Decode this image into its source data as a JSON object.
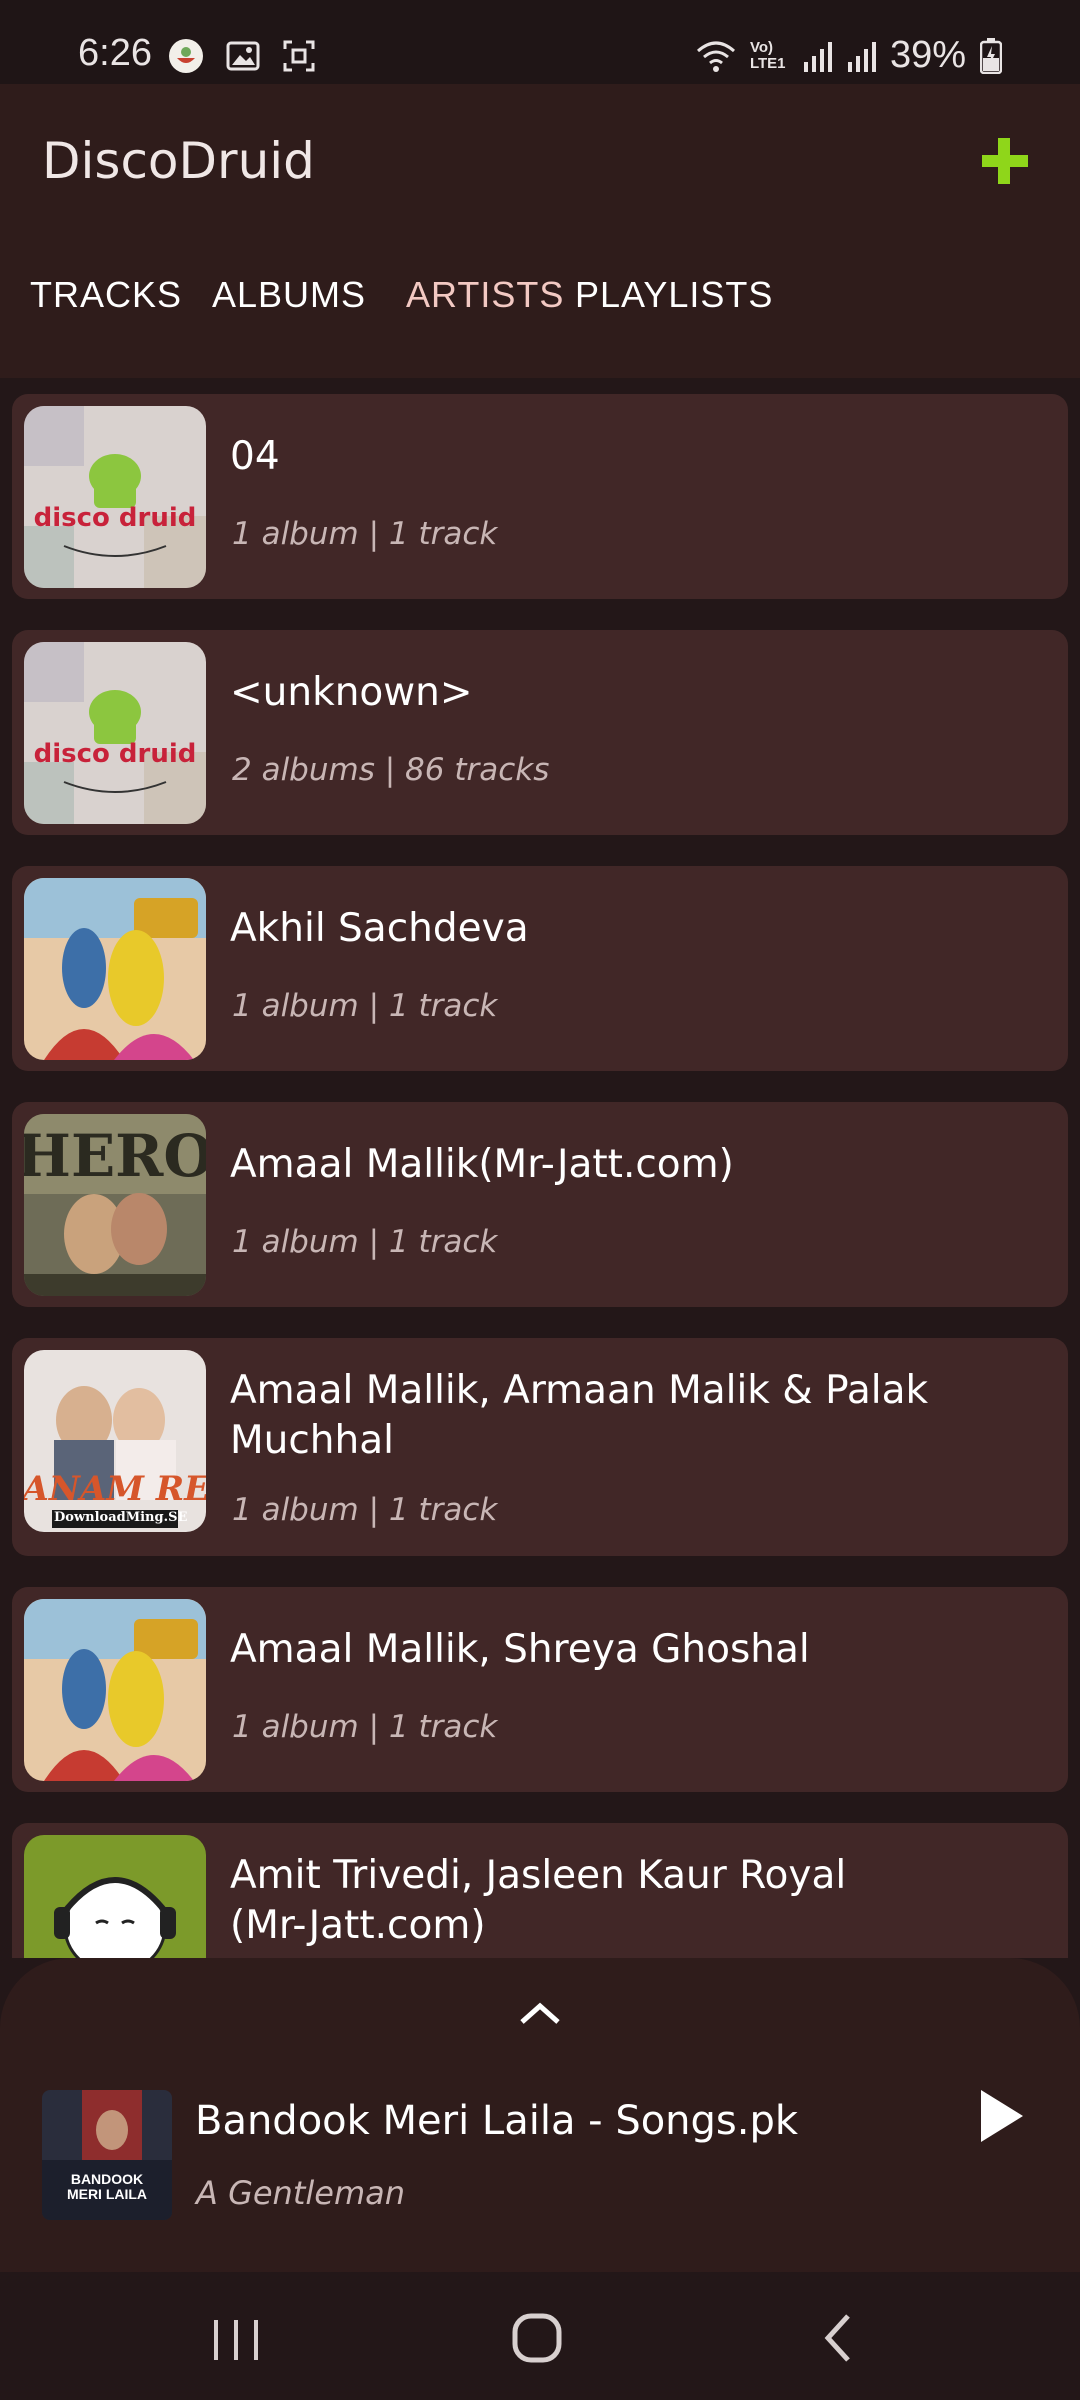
{
  "status_bar": {
    "time": "6:26",
    "battery_percent": "39%",
    "network_label": "Vo) LTE1",
    "left_icons": [
      "app-notification-icon",
      "image-icon",
      "screenshot-icon"
    ],
    "right_icons": [
      "wifi-icon",
      "volte-icon",
      "signal-icon",
      "signal-icon",
      "battery-charging-icon"
    ]
  },
  "app_bar": {
    "title": "DiscoDruid",
    "add_icon": "plus-icon",
    "accent_color": "#8fd61a"
  },
  "tabs": [
    {
      "label": "TRACKS",
      "active": false
    },
    {
      "label": "ALBUMS",
      "active": false
    },
    {
      "label": "ARTISTS",
      "active": true
    },
    {
      "label": "PLAYLISTS",
      "active": false
    }
  ],
  "artists": [
    {
      "name": "04",
      "meta": "1 album | 1 track",
      "art": "disco-druid-logo"
    },
    {
      "name": "<unknown>",
      "meta": "2 albums | 86 tracks",
      "art": "disco-druid-logo"
    },
    {
      "name": "Akhil Sachdeva",
      "meta": "1 album | 1 track",
      "art": "badrinath-poster"
    },
    {
      "name": "Amaal Mallik(Mr-Jatt.com)",
      "meta": "1 album | 1 track",
      "art": "hero-poster"
    },
    {
      "name": "Amaal Mallik, Armaan Malik & Palak Muchhal",
      "meta": "1 album | 1 track",
      "art": "sanam-re-poster",
      "art_caption": "DownloadMing.SE"
    },
    {
      "name": "Amaal Mallik, Shreya Ghoshal",
      "meta": "1 album | 1 track",
      "art": "badrinath-poster"
    },
    {
      "name": "Amit Trivedi, Jasleen Kaur Royal (Mr-Jatt.com)",
      "meta": "",
      "art": "headphone-character"
    }
  ],
  "now_playing": {
    "title": "Bandook Meri Laila - Songs.pk",
    "artist": "A Gentleman",
    "expand_icon": "chevron-up-icon",
    "play_icon": "play-icon",
    "art_caption": "BANDOOK MERI LAILA"
  },
  "nav_bar": {
    "recents_icon": "recents-icon",
    "home_icon": "home-icon",
    "back_icon": "back-icon"
  }
}
